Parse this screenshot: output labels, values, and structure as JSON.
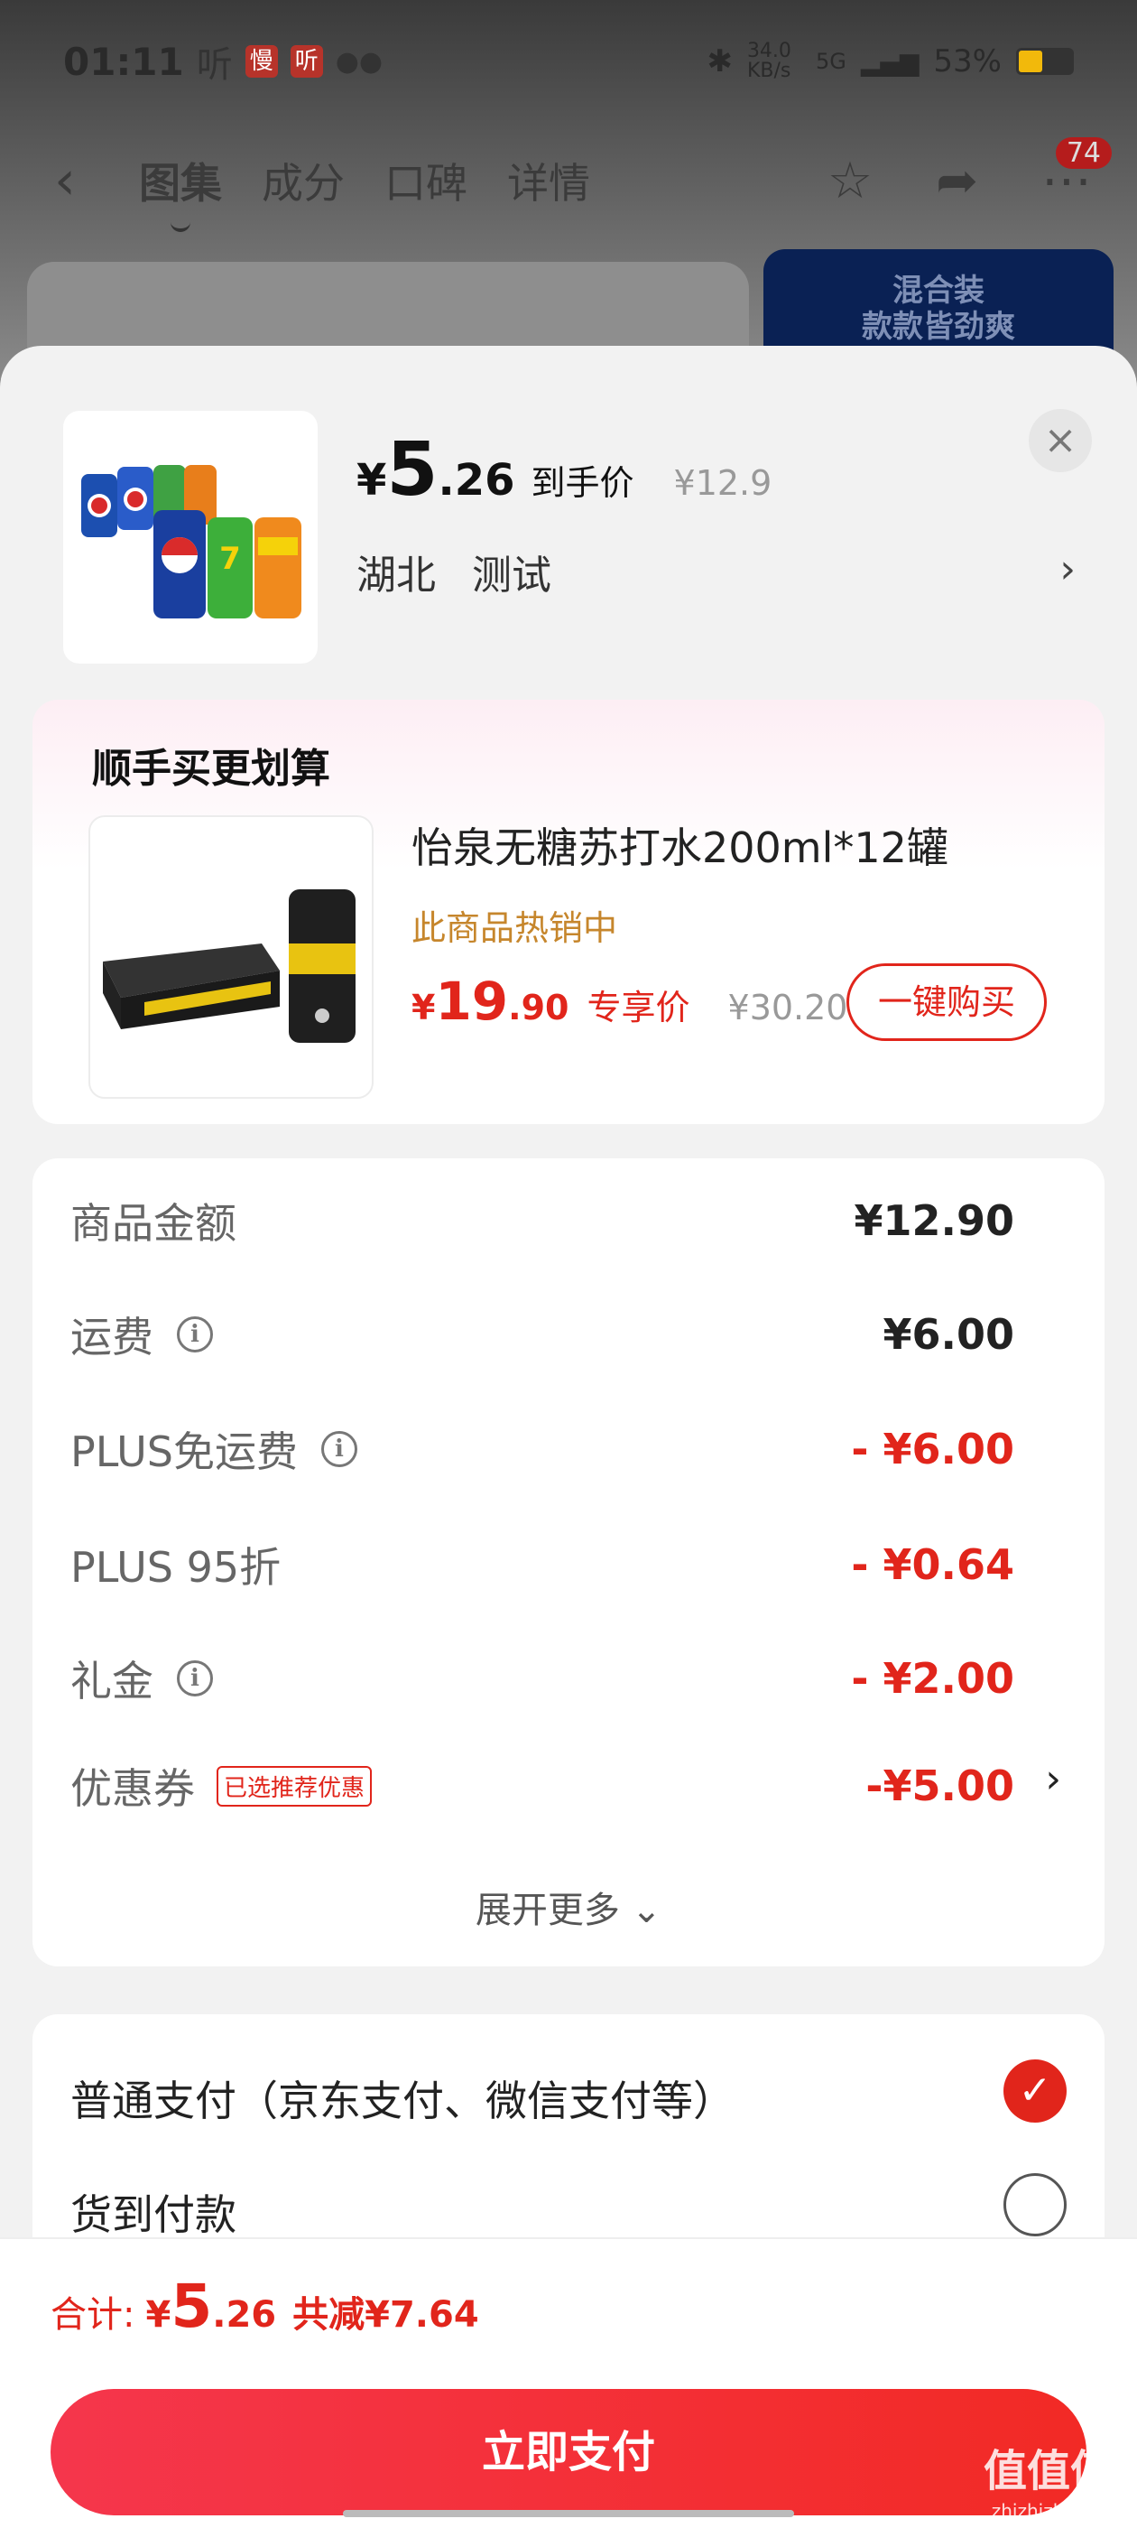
{
  "status_bar": {
    "time": "01:11",
    "app1": "听",
    "app2": "慢",
    "app3": "听",
    "network": "34.0 KB/s",
    "signal": "5G",
    "battery": "53%"
  },
  "nav": {
    "tabs": [
      "图集",
      "成分",
      "口碑",
      "详情"
    ],
    "badge": "74"
  },
  "banner": {
    "line1": "混合装",
    "line2": "款款皆劲爽"
  },
  "product": {
    "currency": "¥",
    "price_int": "5",
    "price_dec": ".26",
    "price_label": "到手价",
    "original": "¥12.9",
    "region": "湖北",
    "location": "测试"
  },
  "upsell": {
    "title": "顺手买更划算",
    "name": "怡泉无糖苏打水200ml*12罐",
    "hot": "此商品热销中",
    "currency": "¥",
    "price_int": "19",
    "price_dec": ".90",
    "price_label": "专享价",
    "original": "¥30.20",
    "buy_label": "一键购买"
  },
  "summary": {
    "rows": [
      {
        "label": "商品金额",
        "value": "¥12.90"
      },
      {
        "label": "运费",
        "value": "¥6.00"
      },
      {
        "label": "PLUS免运费",
        "value": "- ¥6.00"
      },
      {
        "label": "PLUS 95折",
        "value": "- ¥0.64"
      },
      {
        "label": "礼金",
        "value": "- ¥2.00"
      },
      {
        "label": "优惠券",
        "tag": "已选推荐优惠",
        "value": "-¥5.00"
      }
    ],
    "more": "展开更多"
  },
  "payment": {
    "options": [
      "普通支付（京东支付、微信支付等）",
      "货到付款"
    ]
  },
  "footer": {
    "total_label": "合计:",
    "currency": "¥",
    "total_int": "5",
    "total_dec": ".26",
    "saved": "共减¥7.64",
    "pay_button": "立即支付"
  },
  "watermark": {
    "text": "值值值",
    "site": "zhizhizhi.com"
  },
  "colors": {
    "accent": "#e1251b",
    "hot": "#c6862c",
    "banner": "#0a2154"
  }
}
